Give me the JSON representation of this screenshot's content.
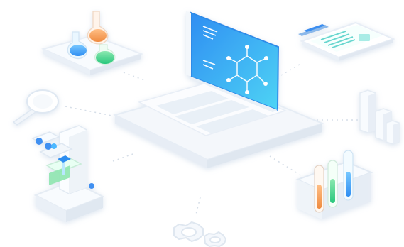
{
  "scene": {
    "elements": [
      "flask-platform-icon",
      "laptop-icon",
      "clipboard-icon",
      "magnifier-icon",
      "bar-chart-icon",
      "microscope-icon",
      "test-tubes-icon",
      "gears-icon"
    ],
    "colors": {
      "screen_start": "#2ea8f2",
      "screen_end": "#4bd0f3",
      "accent_teal": "#30c7c7",
      "accent_green": "#44d07f",
      "accent_orange": "#f7a260",
      "accent_blue": "#3a8ef6",
      "base_white": "#f5f8fc",
      "shadow": "#e7edf5"
    }
  }
}
